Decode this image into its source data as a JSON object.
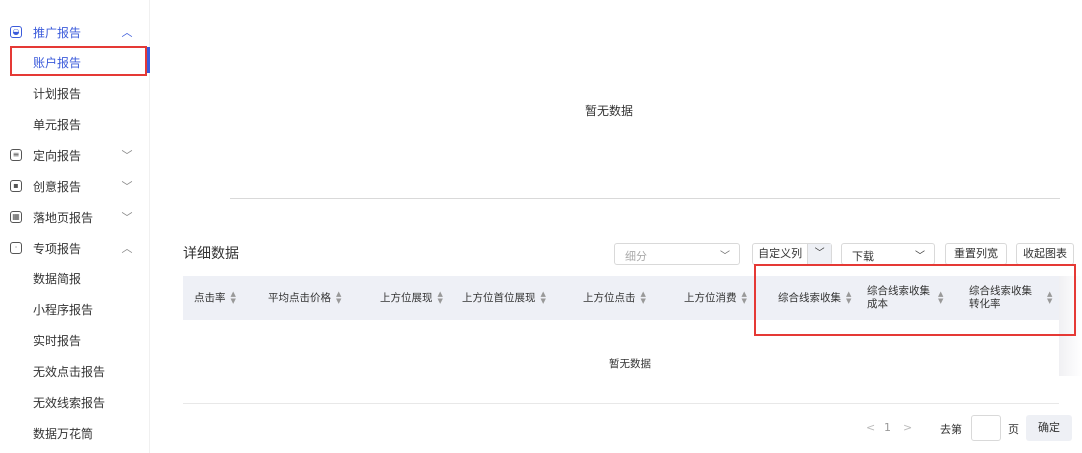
{
  "sidebar": {
    "groups": [
      {
        "label": "推广报告",
        "icon": "chart-icon",
        "chevron": "^",
        "items": [
          "账户报告",
          "计划报告",
          "单元报告"
        ]
      },
      {
        "label": "定向报告",
        "icon": "target-icon",
        "chevron": "v"
      },
      {
        "label": "创意报告",
        "icon": "creative-icon",
        "chevron": "v"
      },
      {
        "label": "落地页报告",
        "icon": "landing-page-icon",
        "chevron": "v"
      },
      {
        "label": "专项报告",
        "icon": "special-report-icon",
        "chevron": "^",
        "items": [
          "数据简报",
          "小程序报告",
          "实时报告",
          "无效点击报告",
          "无效线索报告",
          "数据万花筒"
        ]
      }
    ],
    "selected": "账户报告"
  },
  "chart": {
    "empty_text": "暂无数据"
  },
  "detail": {
    "title": "详细数据",
    "split_placeholder": "细分",
    "custom_columns_label": "自定义列",
    "download_label": "下载",
    "reset_width_label": "重置列宽",
    "collapse_chart_label": "收起图表",
    "columns": [
      "点击率",
      "平均点击价格",
      "上方位展现",
      "上方位首位展现",
      "上方位点击",
      "上方位消费",
      "综合线索收集",
      "综合线索收集成本",
      "综合线索收集转化率"
    ],
    "empty_text": "暂无数据"
  },
  "pagination": {
    "prev": "<",
    "current_page": "1",
    "next": ">",
    "goto_label": "去第",
    "page_label": "页",
    "confirm_label": "确定"
  },
  "colors": {
    "accent": "#3b5bdb",
    "highlight_box": "#e53935",
    "table_header_bg": "#eef0f6"
  }
}
